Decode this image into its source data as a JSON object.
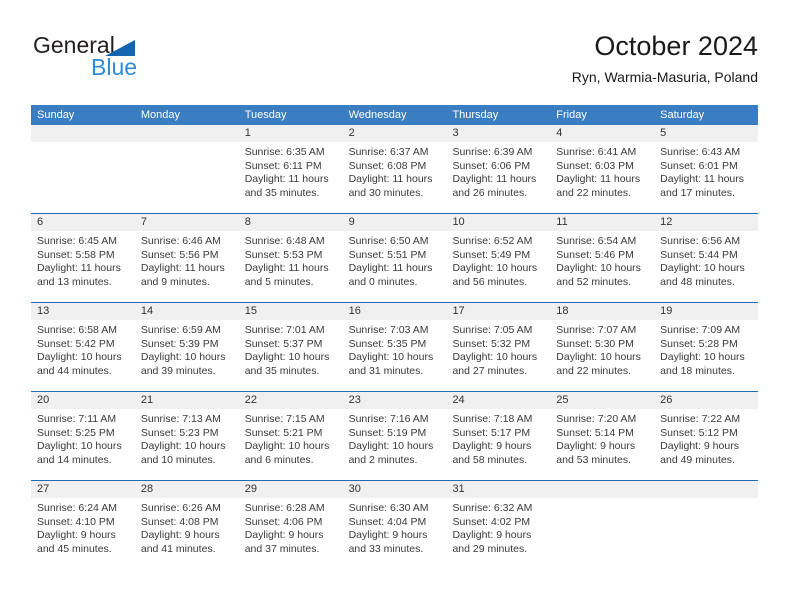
{
  "brand": {
    "name_part1": "General",
    "name_part2": "Blue",
    "triangle_color": "#1266b0",
    "blue_text_color": "#2e8bd8"
  },
  "header": {
    "title": "October 2024",
    "subtitle": "Ryn, Warmia-Masuria, Poland"
  },
  "theme": {
    "header_bg": "#3a7dc0",
    "week_divider": "#1f6cb0",
    "date_band": "#f0f0f0",
    "text": "#3a3a3a"
  },
  "weekdays": [
    "Sunday",
    "Monday",
    "Tuesday",
    "Wednesday",
    "Thursday",
    "Friday",
    "Saturday"
  ],
  "weeks": [
    [
      {
        "date": "",
        "sunrise": "",
        "sunset": "",
        "daylight1": "",
        "daylight2": ""
      },
      {
        "date": "",
        "sunrise": "",
        "sunset": "",
        "daylight1": "",
        "daylight2": ""
      },
      {
        "date": "1",
        "sunrise": "Sunrise: 6:35 AM",
        "sunset": "Sunset: 6:11 PM",
        "daylight1": "Daylight: 11 hours",
        "daylight2": "and 35 minutes."
      },
      {
        "date": "2",
        "sunrise": "Sunrise: 6:37 AM",
        "sunset": "Sunset: 6:08 PM",
        "daylight1": "Daylight: 11 hours",
        "daylight2": "and 30 minutes."
      },
      {
        "date": "3",
        "sunrise": "Sunrise: 6:39 AM",
        "sunset": "Sunset: 6:06 PM",
        "daylight1": "Daylight: 11 hours",
        "daylight2": "and 26 minutes."
      },
      {
        "date": "4",
        "sunrise": "Sunrise: 6:41 AM",
        "sunset": "Sunset: 6:03 PM",
        "daylight1": "Daylight: 11 hours",
        "daylight2": "and 22 minutes."
      },
      {
        "date": "5",
        "sunrise": "Sunrise: 6:43 AM",
        "sunset": "Sunset: 6:01 PM",
        "daylight1": "Daylight: 11 hours",
        "daylight2": "and 17 minutes."
      }
    ],
    [
      {
        "date": "6",
        "sunrise": "Sunrise: 6:45 AM",
        "sunset": "Sunset: 5:58 PM",
        "daylight1": "Daylight: 11 hours",
        "daylight2": "and 13 minutes."
      },
      {
        "date": "7",
        "sunrise": "Sunrise: 6:46 AM",
        "sunset": "Sunset: 5:56 PM",
        "daylight1": "Daylight: 11 hours",
        "daylight2": "and 9 minutes."
      },
      {
        "date": "8",
        "sunrise": "Sunrise: 6:48 AM",
        "sunset": "Sunset: 5:53 PM",
        "daylight1": "Daylight: 11 hours",
        "daylight2": "and 5 minutes."
      },
      {
        "date": "9",
        "sunrise": "Sunrise: 6:50 AM",
        "sunset": "Sunset: 5:51 PM",
        "daylight1": "Daylight: 11 hours",
        "daylight2": "and 0 minutes."
      },
      {
        "date": "10",
        "sunrise": "Sunrise: 6:52 AM",
        "sunset": "Sunset: 5:49 PM",
        "daylight1": "Daylight: 10 hours",
        "daylight2": "and 56 minutes."
      },
      {
        "date": "11",
        "sunrise": "Sunrise: 6:54 AM",
        "sunset": "Sunset: 5:46 PM",
        "daylight1": "Daylight: 10 hours",
        "daylight2": "and 52 minutes."
      },
      {
        "date": "12",
        "sunrise": "Sunrise: 6:56 AM",
        "sunset": "Sunset: 5:44 PM",
        "daylight1": "Daylight: 10 hours",
        "daylight2": "and 48 minutes."
      }
    ],
    [
      {
        "date": "13",
        "sunrise": "Sunrise: 6:58 AM",
        "sunset": "Sunset: 5:42 PM",
        "daylight1": "Daylight: 10 hours",
        "daylight2": "and 44 minutes."
      },
      {
        "date": "14",
        "sunrise": "Sunrise: 6:59 AM",
        "sunset": "Sunset: 5:39 PM",
        "daylight1": "Daylight: 10 hours",
        "daylight2": "and 39 minutes."
      },
      {
        "date": "15",
        "sunrise": "Sunrise: 7:01 AM",
        "sunset": "Sunset: 5:37 PM",
        "daylight1": "Daylight: 10 hours",
        "daylight2": "and 35 minutes."
      },
      {
        "date": "16",
        "sunrise": "Sunrise: 7:03 AM",
        "sunset": "Sunset: 5:35 PM",
        "daylight1": "Daylight: 10 hours",
        "daylight2": "and 31 minutes."
      },
      {
        "date": "17",
        "sunrise": "Sunrise: 7:05 AM",
        "sunset": "Sunset: 5:32 PM",
        "daylight1": "Daylight: 10 hours",
        "daylight2": "and 27 minutes."
      },
      {
        "date": "18",
        "sunrise": "Sunrise: 7:07 AM",
        "sunset": "Sunset: 5:30 PM",
        "daylight1": "Daylight: 10 hours",
        "daylight2": "and 22 minutes."
      },
      {
        "date": "19",
        "sunrise": "Sunrise: 7:09 AM",
        "sunset": "Sunset: 5:28 PM",
        "daylight1": "Daylight: 10 hours",
        "daylight2": "and 18 minutes."
      }
    ],
    [
      {
        "date": "20",
        "sunrise": "Sunrise: 7:11 AM",
        "sunset": "Sunset: 5:25 PM",
        "daylight1": "Daylight: 10 hours",
        "daylight2": "and 14 minutes."
      },
      {
        "date": "21",
        "sunrise": "Sunrise: 7:13 AM",
        "sunset": "Sunset: 5:23 PM",
        "daylight1": "Daylight: 10 hours",
        "daylight2": "and 10 minutes."
      },
      {
        "date": "22",
        "sunrise": "Sunrise: 7:15 AM",
        "sunset": "Sunset: 5:21 PM",
        "daylight1": "Daylight: 10 hours",
        "daylight2": "and 6 minutes."
      },
      {
        "date": "23",
        "sunrise": "Sunrise: 7:16 AM",
        "sunset": "Sunset: 5:19 PM",
        "daylight1": "Daylight: 10 hours",
        "daylight2": "and 2 minutes."
      },
      {
        "date": "24",
        "sunrise": "Sunrise: 7:18 AM",
        "sunset": "Sunset: 5:17 PM",
        "daylight1": "Daylight: 9 hours",
        "daylight2": "and 58 minutes."
      },
      {
        "date": "25",
        "sunrise": "Sunrise: 7:20 AM",
        "sunset": "Sunset: 5:14 PM",
        "daylight1": "Daylight: 9 hours",
        "daylight2": "and 53 minutes."
      },
      {
        "date": "26",
        "sunrise": "Sunrise: 7:22 AM",
        "sunset": "Sunset: 5:12 PM",
        "daylight1": "Daylight: 9 hours",
        "daylight2": "and 49 minutes."
      }
    ],
    [
      {
        "date": "27",
        "sunrise": "Sunrise: 6:24 AM",
        "sunset": "Sunset: 4:10 PM",
        "daylight1": "Daylight: 9 hours",
        "daylight2": "and 45 minutes."
      },
      {
        "date": "28",
        "sunrise": "Sunrise: 6:26 AM",
        "sunset": "Sunset: 4:08 PM",
        "daylight1": "Daylight: 9 hours",
        "daylight2": "and 41 minutes."
      },
      {
        "date": "29",
        "sunrise": "Sunrise: 6:28 AM",
        "sunset": "Sunset: 4:06 PM",
        "daylight1": "Daylight: 9 hours",
        "daylight2": "and 37 minutes."
      },
      {
        "date": "30",
        "sunrise": "Sunrise: 6:30 AM",
        "sunset": "Sunset: 4:04 PM",
        "daylight1": "Daylight: 9 hours",
        "daylight2": "and 33 minutes."
      },
      {
        "date": "31",
        "sunrise": "Sunrise: 6:32 AM",
        "sunset": "Sunset: 4:02 PM",
        "daylight1": "Daylight: 9 hours",
        "daylight2": "and 29 minutes."
      },
      {
        "date": "",
        "sunrise": "",
        "sunset": "",
        "daylight1": "",
        "daylight2": ""
      },
      {
        "date": "",
        "sunrise": "",
        "sunset": "",
        "daylight1": "",
        "daylight2": ""
      }
    ]
  ]
}
